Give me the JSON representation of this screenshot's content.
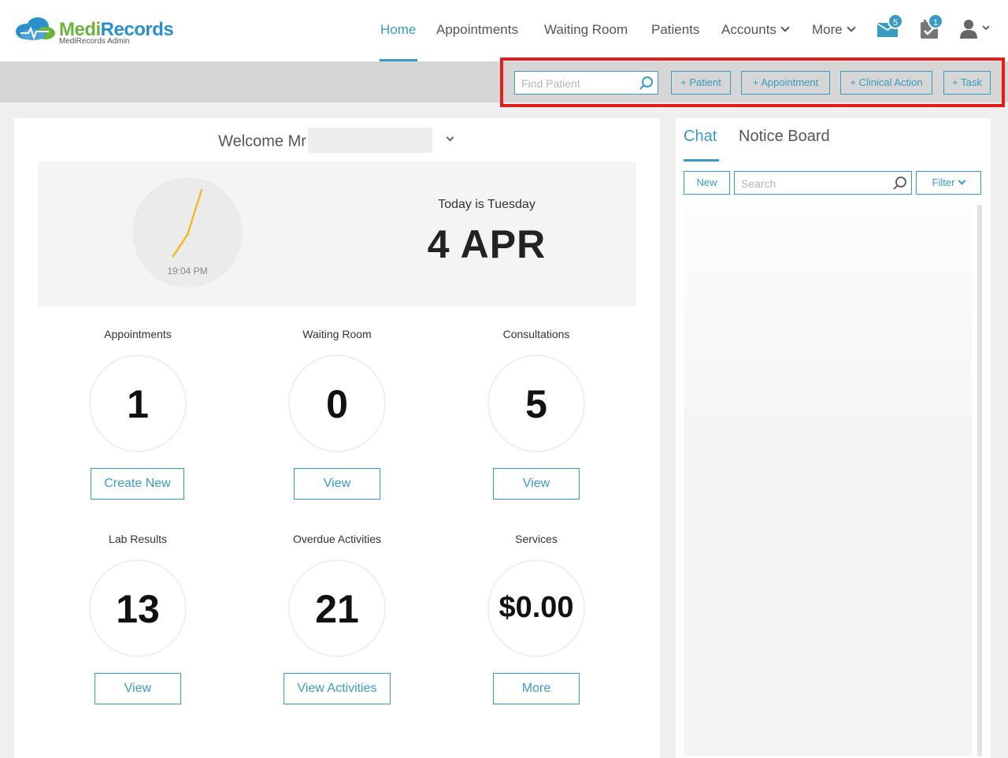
{
  "app": {
    "logo_medi": "Medi",
    "logo_records": "Records",
    "logo_sub": "MediRecords Admin"
  },
  "nav": {
    "items": [
      {
        "label": "Home",
        "active": true
      },
      {
        "label": "Appointments"
      },
      {
        "label": "Waiting Room"
      },
      {
        "label": "Patients"
      },
      {
        "label": "Accounts",
        "dropdown": true
      },
      {
        "label": "More",
        "dropdown": true
      }
    ],
    "mail_badge": "5",
    "tasks_badge": "1",
    "icons": [
      "mail-icon",
      "tasks-icon",
      "user-icon"
    ]
  },
  "actionbar": {
    "find_placeholder": "Find Patient",
    "buttons": [
      "+ Patient",
      "+ Appointment",
      "+ Clinical Action",
      "+ Task"
    ]
  },
  "welcome": {
    "text": "Welcome Mr"
  },
  "date_card": {
    "clock_time": "19:04 PM",
    "today_label": "Today is Tuesday",
    "date": "4 APR"
  },
  "stats": [
    {
      "label": "Appointments",
      "value": "1",
      "button": "Create New"
    },
    {
      "label": "Waiting Room",
      "value": "0",
      "button": "View"
    },
    {
      "label": "Consultations",
      "value": "5",
      "button": "View"
    },
    {
      "label": "Lab Results",
      "value": "13",
      "button": "View"
    },
    {
      "label": "Overdue Activities",
      "value": "21",
      "button": "View Activities"
    },
    {
      "label": "Services",
      "value": "$0.00",
      "button": "More"
    }
  ],
  "chat_panel": {
    "tabs": [
      "Chat",
      "Notice Board"
    ],
    "new_label": "New",
    "search_placeholder": "Search",
    "filter_label": "Filter"
  },
  "colors": {
    "accent": "#3a9bc1",
    "logo_green": "#6ab43e",
    "logo_blue": "#2b8fc9",
    "highlight_red": "#e31b1b"
  }
}
